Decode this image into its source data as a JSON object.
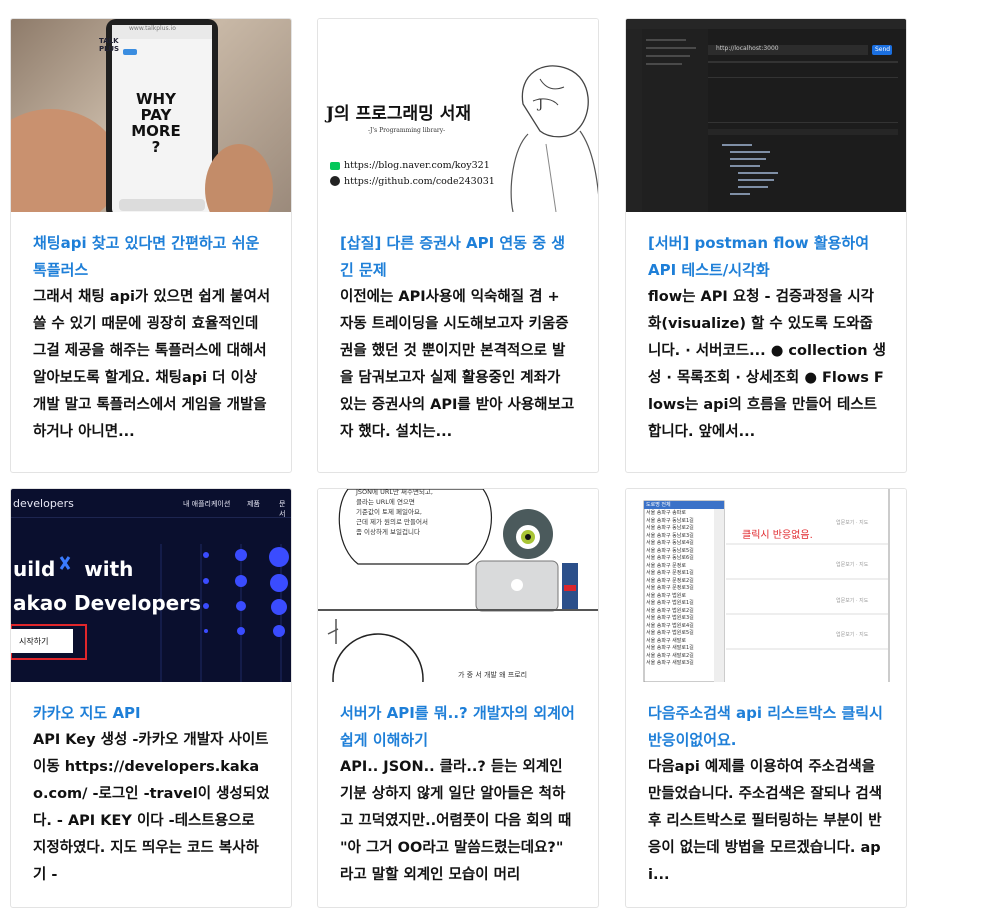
{
  "cards": [
    {
      "title": "채팅api 찾고 있다면 간편하고 쉬운 톡플러스",
      "excerpt": "그래서 채팅 api가 있으면 쉽게 붙여서 쓸 수 있기 때문에 굉장히 효율적인데 그걸 제공을 해주는 톡플러스에 대해서 알아보도록 할게요. 채팅api 더 이상 개발 말고 톡플러스에서 게임을 개발을 하거나 아니면...",
      "thumb": {
        "logo_top": "TALK",
        "logo_bottom": "PLUS",
        "headline": "WHY\nPAY\nMORE\n?",
        "url": "www.talkplus.io"
      }
    },
    {
      "title": "[삽질] 다른 증권사 API 연동 중 생긴 문제",
      "excerpt": "이전에는 API사용에 익숙해질 겸 + 자동 트레이딩을 시도해보고자 키움증권을 했던 것 뿐이지만 본격적으로 발을 담궈보고자 실제 활용중인 계좌가 있는 증권사의 API를 받아 사용해보고자 했다. 설치는...",
      "thumb": {
        "heading": "J의 프로그래밍 서재",
        "subheading": "-J's Programming library-",
        "blog": "https://blog.naver.com/koy321",
        "github": "https://github.com/code243031",
        "char": "J"
      }
    },
    {
      "title": "[서버] postman flow 활용하여 API 테스트/시각화",
      "excerpt": "flow는 API 요청 - 검증과정을 시각화(visualize) 할 수 있도록 도와줍니다. · 서버코드... ● collection 생성 · 목록조회 · 상세조회 ● Flows Flows는 api의 흐름을 만들어 테스트합니다. 앞에서...",
      "thumb": {
        "url": "http://localhost:3000",
        "send": "Send"
      }
    },
    {
      "title": "카카오 지도 API",
      "excerpt": "API Key 생성 -카카오 개발자 사이트 이동 https://developers.kakao.com/ -로그인 -travel이 생성되었다. - API KEY 이다 -테스트용으로 지정하였다. 지도 띄우는 코드 복사하기 -",
      "thumb": {
        "brand": "developers",
        "nav1": "내 애플리케이션",
        "nav2": "제품",
        "nav3": "문서",
        "line1": "uild",
        "line1b": "with",
        "line2": "akao Developers",
        "button": "시작하기"
      }
    },
    {
      "title": "서버가 API를 뭐..? 개발자의 외계어 쉽게 이해하기",
      "excerpt": "API.. JSON.. 클라..? 듣는 외계인 기분 상하지 않게 일단 알아들은 척하고 끄덕였지만..어렴풋이 다음 회의 때 \"아 그거 OO라고 말씀드렸는데요?\" 라고 말할 외계인 모습이 머리",
      "thumb": {
        "bubble": "JSON에 URL만 써주면되고,\n클라는 URL에 연으면\n기준값이 토제 페일아요,\n근데 제가 원의로 만들어서\n좀 이상하게 보일겁니다",
        "caption": "가 중 서 개발 왜 프로리"
      }
    },
    {
      "title": "다음주소검색 api 리스트박스 클릭시 반응이없어요.",
      "excerpt": "다음api 예제를 이용하여 주소검색을 만들었습니다. 주소검색은 잘되나 검색후 리스트박스로 필터링하는 부분이 반응이 없는데 방법을 모르겠습니다. api...",
      "thumb": {
        "notice": "클릭시 반응없음.",
        "list_head": "도로명 전체",
        "rows": [
          "서울 송파구 송파로",
          "서울 송파구 동남로1길",
          "서울 송파구 동남로2길",
          "서울 송파구 동남로3길",
          "서울 송파구 동남로4길",
          "서울 송파구 동남로5길",
          "서울 송파구 동남로6길",
          "서울 송파구 문정로",
          "서울 송파구 문정로1길",
          "서울 송파구 문정로2길",
          "서울 송파구 문정로3길",
          "서울 송파구 법원로",
          "서울 송파구 법원로1길",
          "서울 송파구 법원로2길",
          "서울 송파구 법원로3길",
          "서울 송파구 법원로4길",
          "서울 송파구 법원로5길",
          "서울 송파구 새말로",
          "서울 송파구 새말로1길",
          "서울 송파구 새말로2길",
          "서울 송파구 새말로3길"
        ],
        "side": "업문보기 · 지도"
      }
    }
  ]
}
